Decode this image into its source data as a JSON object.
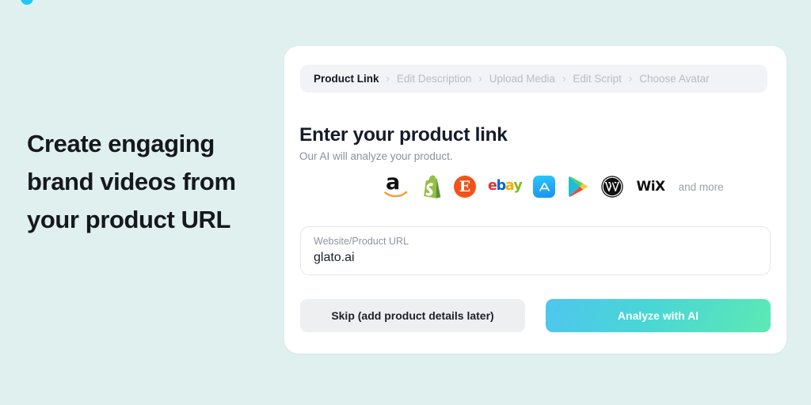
{
  "page": {
    "background_color": "#dff0ef",
    "accent_color": "#22c8f0"
  },
  "hero": {
    "headline": "Create engaging brand videos from your product URL"
  },
  "card": {
    "breadcrumb": {
      "separator": "›",
      "steps": [
        {
          "label": "Product Link",
          "active": true
        },
        {
          "label": "Edit Description",
          "active": false
        },
        {
          "label": "Upload Media",
          "active": false
        },
        {
          "label": "Edit Script",
          "active": false
        },
        {
          "label": "Choose Avatar",
          "active": false
        }
      ]
    },
    "title": "Enter your product link",
    "subtitle": "Our AI will analyze your product.",
    "logos": [
      {
        "name": "amazon-logo",
        "label": "amazon"
      },
      {
        "name": "shopify-logo",
        "label": "Shopify"
      },
      {
        "name": "etsy-logo",
        "label": "Etsy"
      },
      {
        "name": "ebay-logo",
        "label": "ebay"
      },
      {
        "name": "app-store-logo",
        "label": "App Store"
      },
      {
        "name": "google-play-logo",
        "label": "Google Play"
      },
      {
        "name": "wordpress-logo",
        "label": "WordPress"
      },
      {
        "name": "wix-logo",
        "label": "WiX"
      }
    ],
    "and_more_label": "and more",
    "url_field": {
      "label": "Website/Product URL",
      "value": "glato.ai",
      "placeholder": "Website/Product URL"
    },
    "skip_button_label": "Skip (add product details later)",
    "analyze_button_label": "Analyze with AI",
    "analyze_button_gradient": [
      "#4fc6ee",
      "#5ce9b3"
    ]
  }
}
